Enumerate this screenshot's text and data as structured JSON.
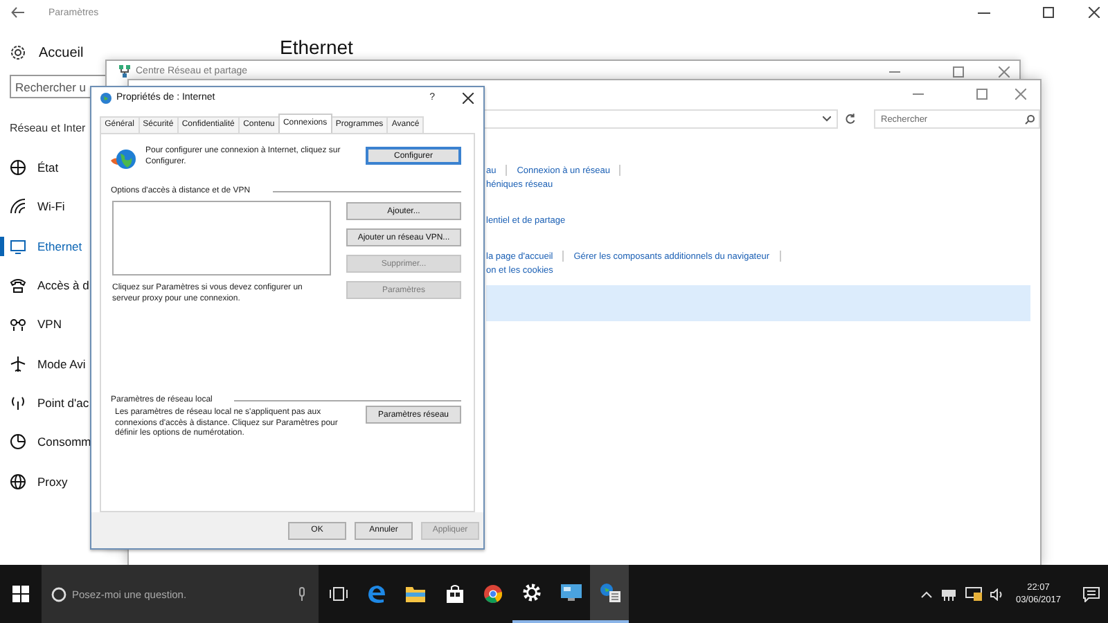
{
  "settings": {
    "title": "Paramètres",
    "heading": "Ethernet",
    "home": "Accueil",
    "search": {
      "placeholder": "Rechercher u"
    },
    "section": "Réseau et Inter",
    "items": [
      {
        "label": "État",
        "kind": "status",
        "selected": false
      },
      {
        "label": "Wi-Fi",
        "kind": "wifi",
        "selected": false
      },
      {
        "label": "Ethernet",
        "kind": "ethernet",
        "selected": true
      },
      {
        "label": "Accès à d",
        "kind": "dialup",
        "selected": false
      },
      {
        "label": "VPN",
        "kind": "vpn",
        "selected": false
      },
      {
        "label": "Mode Avi",
        "kind": "airplane",
        "selected": false
      },
      {
        "label": "Point d'ac",
        "kind": "hotspot",
        "selected": false
      },
      {
        "label": "Consomm",
        "kind": "usage",
        "selected": false
      },
      {
        "label": "Proxy",
        "kind": "proxy",
        "selected": false
      }
    ]
  },
  "network_center": {
    "title": "Centre Réseau et partage"
  },
  "control_window": {
    "search": {
      "placeholder": "Rechercher"
    },
    "sections": [
      {
        "rows": [
          {
            "links": [
              "au",
              "Connexion à un réseau"
            ],
            "separated": true
          },
          {
            "links": [
              "héniques réseau"
            ],
            "separated": false
          }
        ]
      },
      {
        "rows": [
          {
            "links": [
              "lentiel et de partage"
            ],
            "separated": false
          }
        ]
      },
      {
        "rows": [
          {
            "links": [
              "la page d'accueil",
              "Gérer les composants additionnels du navigateur"
            ],
            "separated": true
          },
          {
            "links": [
              "on et les cookies"
            ],
            "separated": false
          }
        ]
      }
    ]
  },
  "dialog": {
    "title": "Propriétés de : Internet",
    "help": "?",
    "tabs": [
      {
        "label": "Général",
        "selected": false
      },
      {
        "label": "Sécurité",
        "selected": false
      },
      {
        "label": "Confidentialité",
        "selected": false
      },
      {
        "label": "Contenu",
        "selected": false
      },
      {
        "label": "Connexions",
        "selected": true
      },
      {
        "label": "Programmes",
        "selected": false
      },
      {
        "label": "Avancé",
        "selected": false
      }
    ],
    "setup_text": "Pour configurer une connexion à Internet, cliquez sur Configurer.",
    "setup_button": "Configurer",
    "vpn_group": "Options d'accès à distance et de VPN",
    "vpn_buttons": [
      {
        "label": "Ajouter...",
        "disabled": false
      },
      {
        "label": "Ajouter un réseau VPN...",
        "disabled": false
      },
      {
        "label": "Supprimer...",
        "disabled": true
      },
      {
        "label": "Paramètres",
        "disabled": true
      }
    ],
    "proxy_text": "Cliquez sur Paramètres si vous devez configurer un serveur proxy pour une connexion.",
    "lan_group": "Paramètres de réseau local",
    "lan_text": "Les paramètres de réseau local ne s'appliquent pas aux connexions d'accès à distance. Cliquez sur Paramètres pour définir les options de numérotation.",
    "lan_button": "Paramètres réseau",
    "footer_buttons": [
      {
        "label": "OK",
        "disabled": false
      },
      {
        "label": "Annuler",
        "disabled": false
      },
      {
        "label": "Appliquer",
        "disabled": true
      }
    ]
  },
  "taskbar": {
    "search": {
      "placeholder": "Posez-moi une question."
    },
    "apps": [
      {
        "kind": "taskview",
        "running": false,
        "selected": false
      },
      {
        "kind": "edge",
        "running": false,
        "selected": false
      },
      {
        "kind": "folder",
        "running": false,
        "selected": false
      },
      {
        "kind": "store",
        "running": false,
        "selected": false
      },
      {
        "kind": "chrome",
        "running": false,
        "selected": false
      },
      {
        "kind": "gear",
        "running": true,
        "selected": false
      },
      {
        "kind": "monitor",
        "running": true,
        "selected": false
      },
      {
        "kind": "network",
        "running": true,
        "selected": true
      }
    ],
    "time": "22:07",
    "date": "03/06/2017"
  }
}
